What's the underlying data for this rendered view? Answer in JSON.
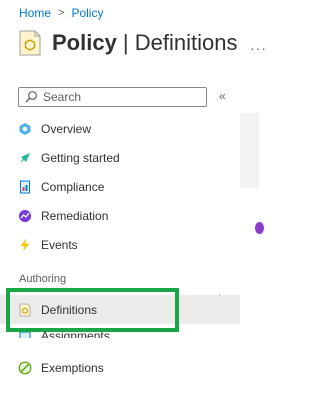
{
  "breadcrumb": {
    "home": "Home",
    "separator": ">",
    "current": "Policy"
  },
  "header": {
    "title_bold": "Policy",
    "title_separator": " | ",
    "title_sub": "Definitions",
    "more_label": "···"
  },
  "search": {
    "placeholder": "Search"
  },
  "collapse_label": "«",
  "nav": {
    "overview": "Overview",
    "getting_started": "Getting started",
    "compliance": "Compliance",
    "remediation": "Remediation",
    "events": "Events",
    "section_authoring": "Authoring",
    "definitions": "Definitions",
    "assignments": "Assignments",
    "exemptions": "Exemptions"
  },
  "colors": {
    "accent": "#0078d4",
    "highlight": "#19a644",
    "selected_bg": "#edebe9"
  }
}
